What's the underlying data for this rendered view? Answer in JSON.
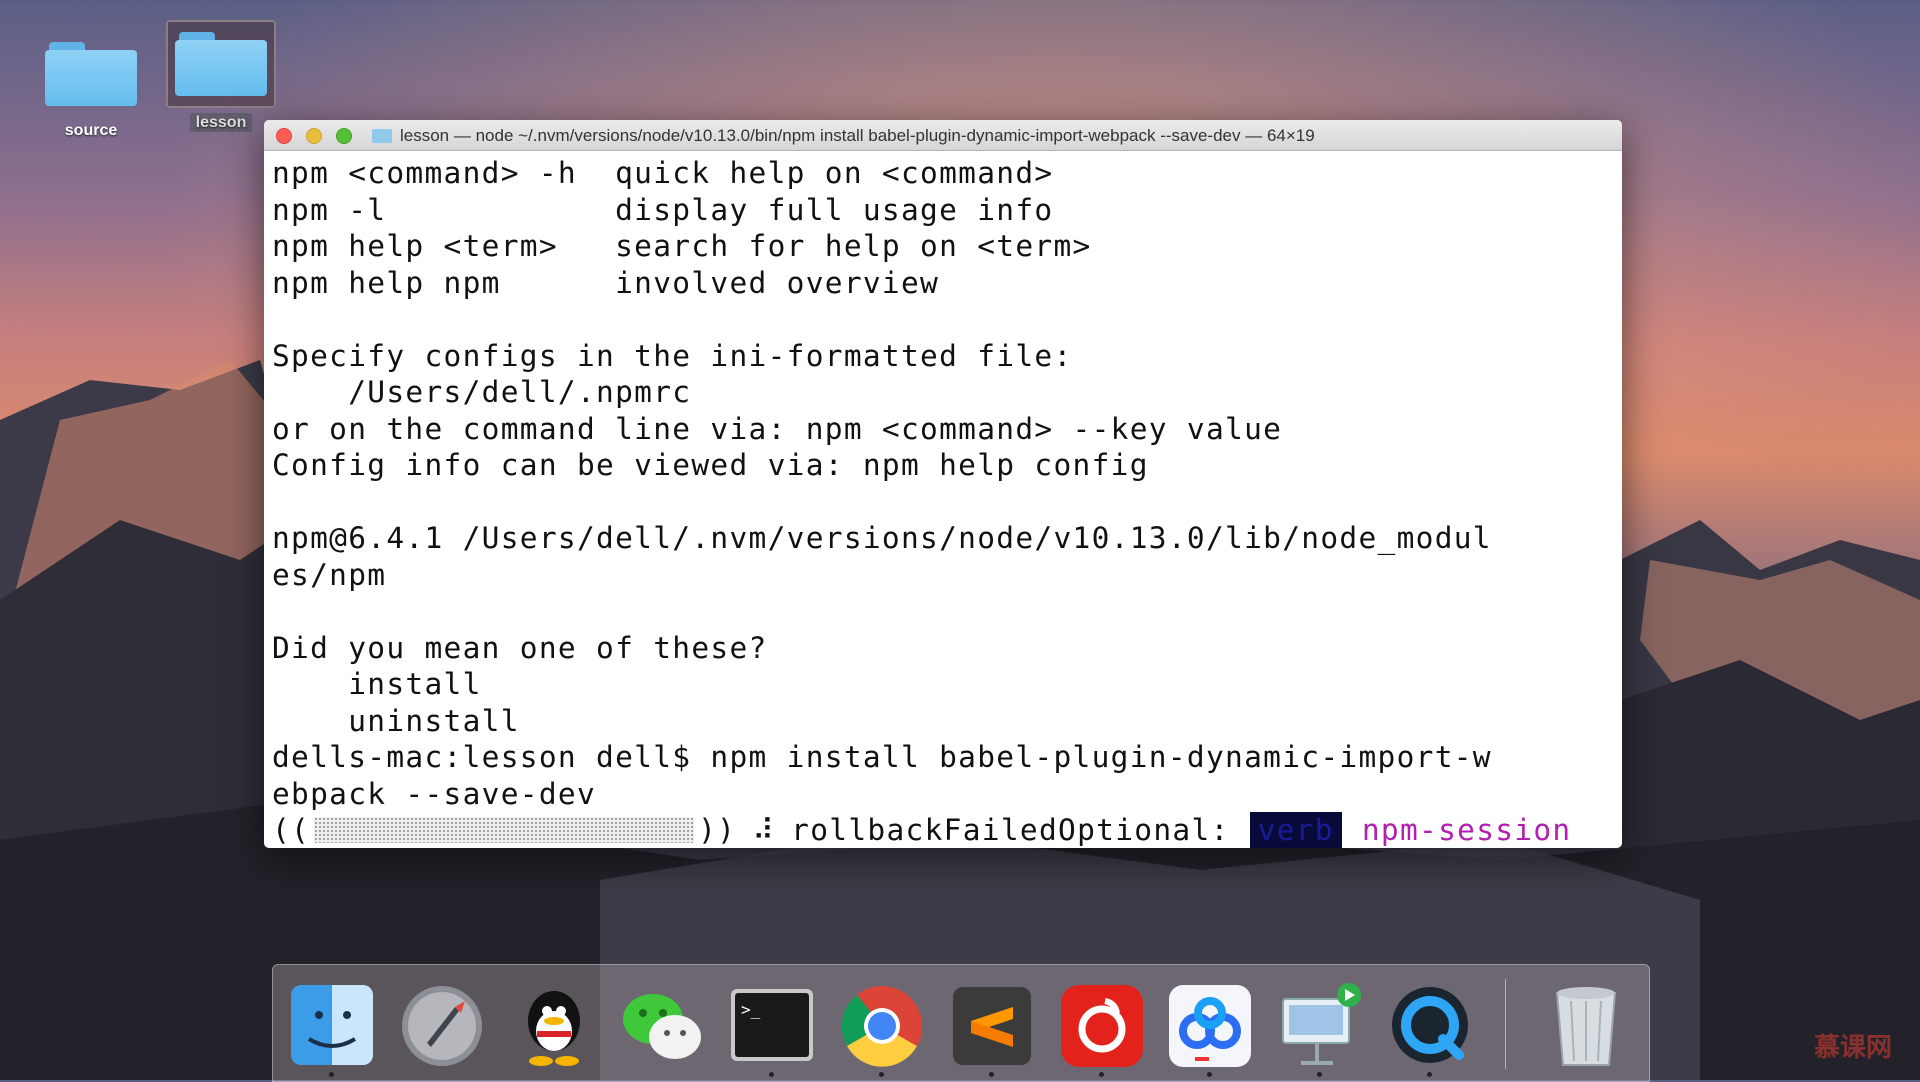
{
  "desktop": {
    "icons": [
      {
        "label": "source"
      },
      {
        "label": "lesson"
      }
    ]
  },
  "terminal": {
    "title": "lesson — node ~/.nvm/versions/node/v10.13.0/bin/npm install babel-plugin-dynamic-import-webpack --save-dev — 64×19",
    "lines": [
      "npm <command> -h  quick help on <command>",
      "npm -l            display full usage info",
      "npm help <term>   search for help on <term>",
      "npm help npm      involved overview",
      "",
      "Specify configs in the ini-formatted file:",
      "    /Users/dell/.npmrc",
      "or on the command line via: npm <command> --key value",
      "Config info can be viewed via: npm help config",
      "",
      "npm@6.4.1 /Users/dell/.nvm/versions/node/v10.13.0/lib/node_modul",
      "es/npm",
      "",
      "Did you mean one of these?",
      "    install",
      "    uninstall",
      "dells-mac:lesson dell$ npm install babel-plugin-dynamic-import-w",
      "ebpack --save-dev"
    ],
    "progress": {
      "open": "((",
      "close": "))",
      "spinner": "⠼",
      "status": "rollbackFailedOptional:",
      "verb": "verb",
      "session": "npm-session"
    }
  },
  "dock": {
    "items": [
      {
        "icon": "finder-icon",
        "running": true
      },
      {
        "icon": "launchpad-icon",
        "running": false
      },
      {
        "icon": "qq-icon",
        "running": false
      },
      {
        "icon": "wechat-icon",
        "running": false
      },
      {
        "icon": "terminal-icon",
        "running": true
      },
      {
        "icon": "chrome-icon",
        "running": true
      },
      {
        "icon": "sublime-text-icon",
        "running": true
      },
      {
        "icon": "netease-music-icon",
        "running": true
      },
      {
        "icon": "baidu-netdisk-icon",
        "running": true
      },
      {
        "icon": "keynote-icon",
        "running": true
      },
      {
        "icon": "quicktime-icon",
        "running": true
      },
      {
        "icon": "trash-icon",
        "running": false
      }
    ]
  },
  "watermark": "慕课网"
}
